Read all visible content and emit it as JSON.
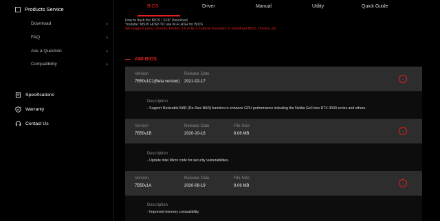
{
  "sidebar": {
    "header": "Products Service",
    "sub_items": [
      "Download",
      "FAQ",
      "Ask a Question",
      "Compatibility"
    ],
    "main_items": [
      {
        "label": "Specifications",
        "icon": "document-icon"
      },
      {
        "label": "Warranty",
        "icon": "shield-icon"
      },
      {
        "label": "Contact Us",
        "icon": "headset-icon"
      }
    ]
  },
  "tabs": [
    "BIOS",
    "Driver",
    "Manual",
    "Utility",
    "Quick Guide"
  ],
  "notes": {
    "line1": "How to flash the BIOS / SOP Download",
    "line2": "Youtube: MSI® HOW-TO use M-FLASH for BIOS",
    "line3": "We suggest using Chrome, Firefox 3.6 or IE 9.0 above browsers to download BIOS, Drivers, etc."
  },
  "section_title": "AMI BIOS",
  "labels": {
    "version": "Version",
    "release_date": "Release Date",
    "file_size": "File Size",
    "description": "Description"
  },
  "entries": [
    {
      "version": "7B50v1C1(Beta version)",
      "release_date": "2021-02-17",
      "file_size": "",
      "description": "- Support Resizable BAR (Re-Size BAR) function to enhance GPU performance including the Nvidia GeForce RTX 3000 series and others."
    },
    {
      "version": "7B50v1B",
      "release_date": "2020-10-16",
      "file_size": "8.06 MB",
      "description": "- Update Intel Micro code for security vulnerabilities."
    },
    {
      "version": "7B50v1A",
      "release_date": "2020-08-19",
      "file_size": "8.06 MB",
      "description": "- Improved memory compatibility."
    }
  ],
  "colors": {
    "accent": "#e02020",
    "card_header": "#2d2d2d",
    "background": "#000000"
  }
}
